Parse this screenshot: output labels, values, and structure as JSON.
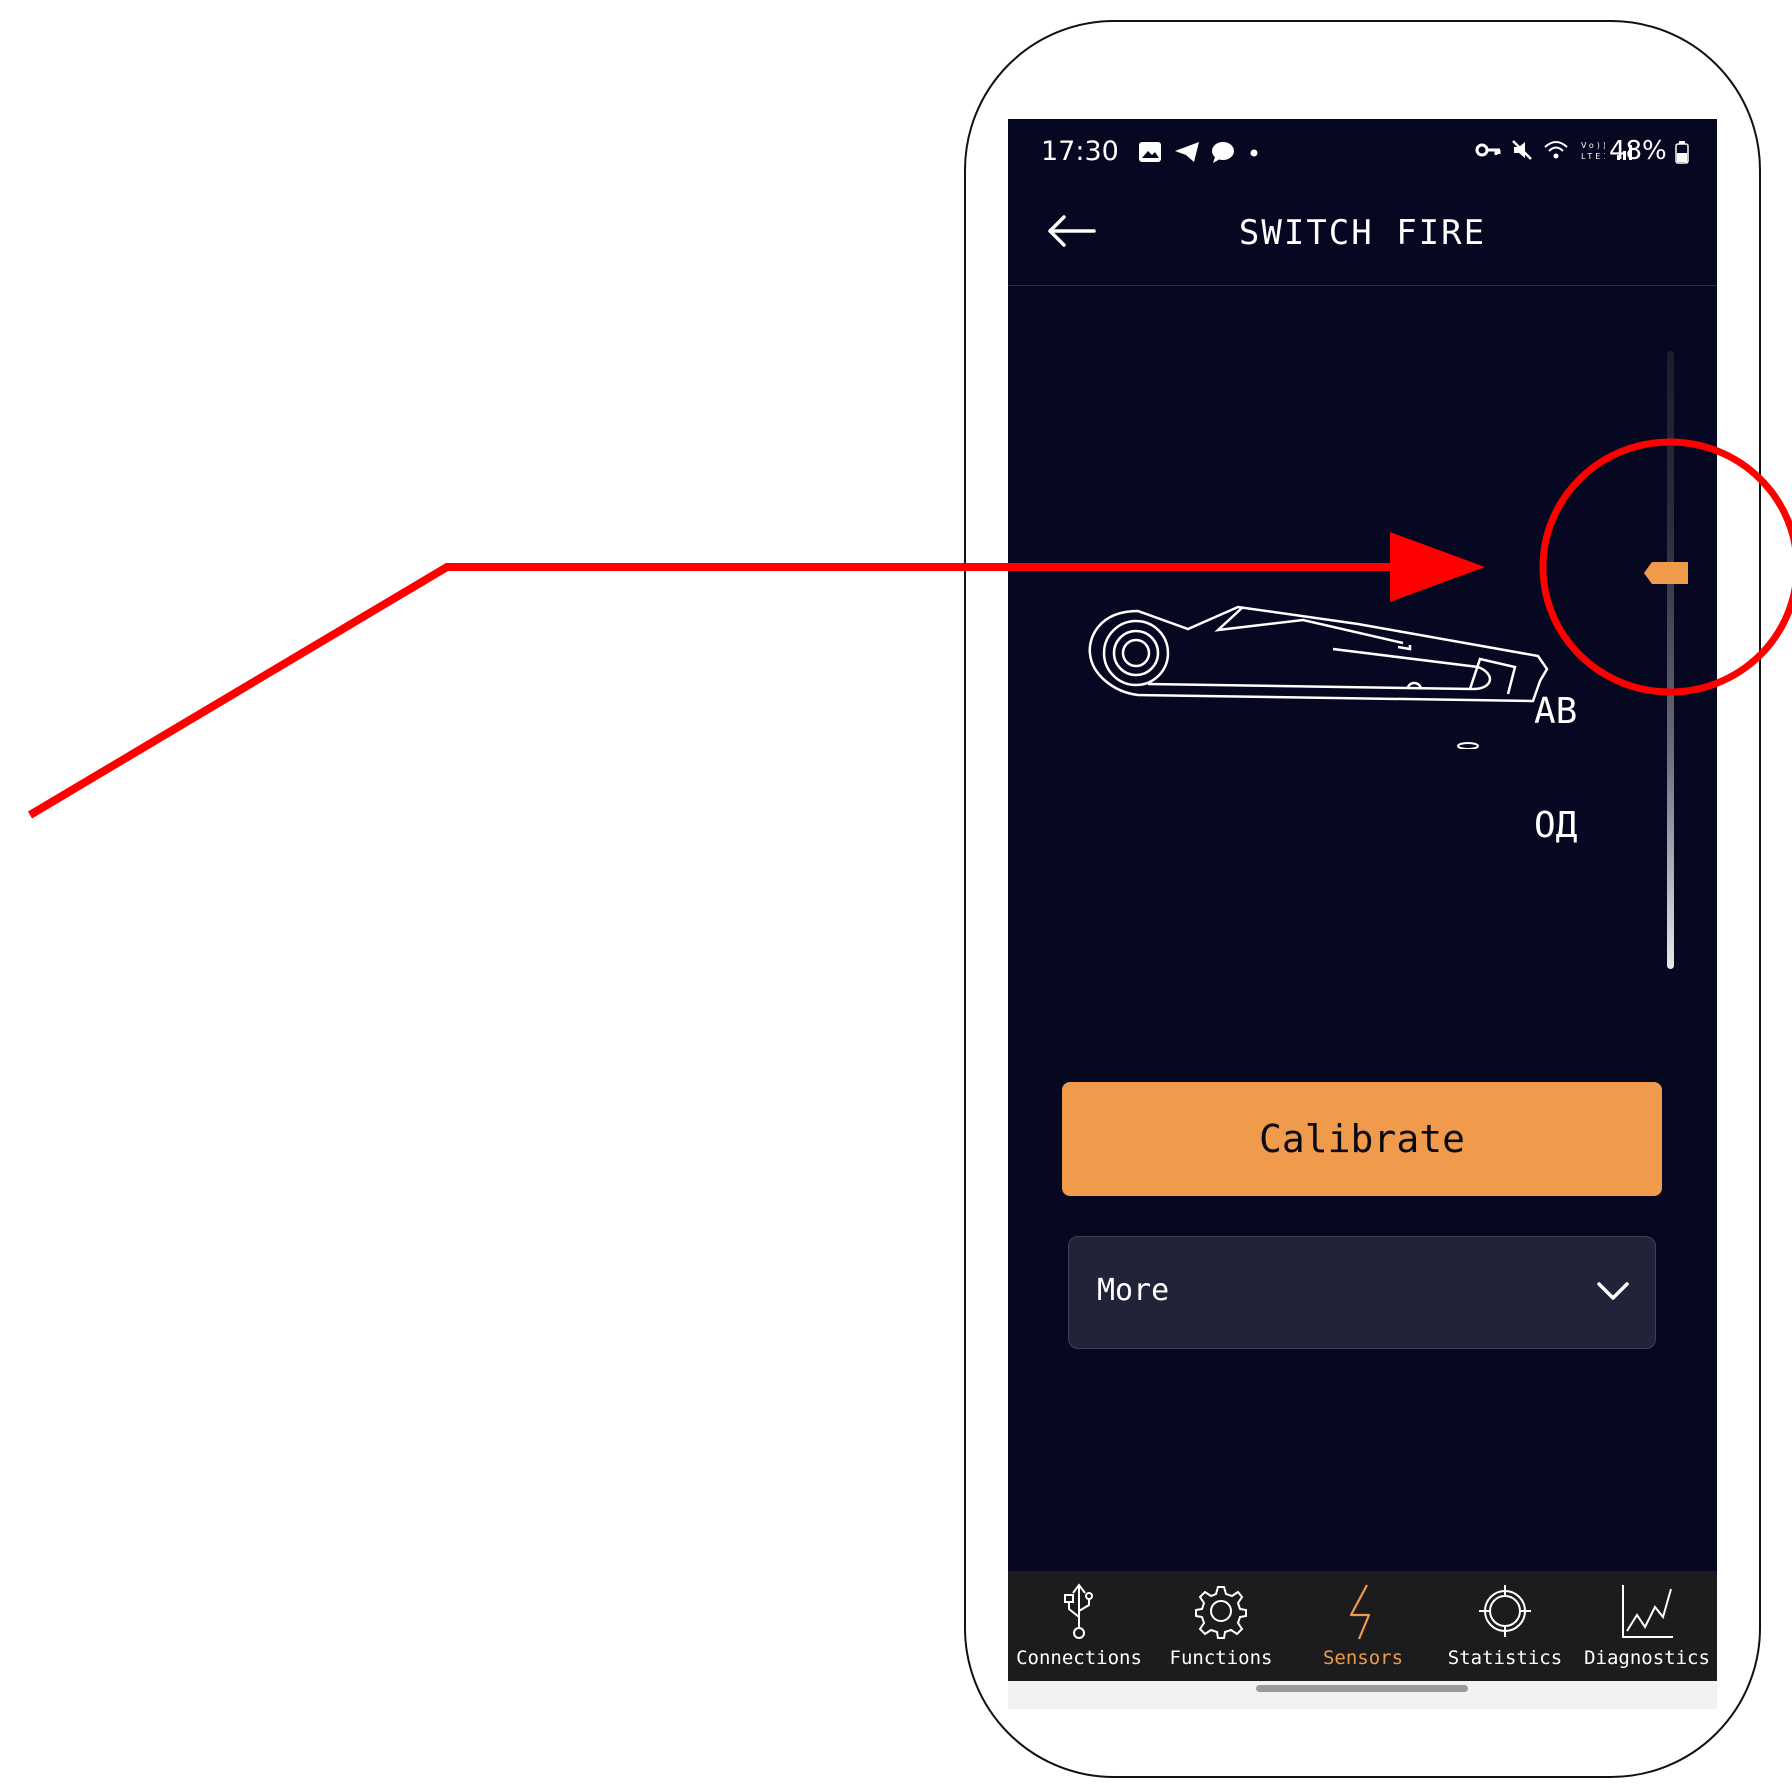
{
  "status_bar": {
    "time": "17:30",
    "left_icons": [
      "image-icon",
      "telegram-icon",
      "chat-icon",
      "dot-icon"
    ],
    "right_icons": [
      "vpn-key-icon",
      "mute-icon",
      "wifi-icon",
      "volte-icon",
      "signal-icon"
    ],
    "battery": "48%"
  },
  "app_bar": {
    "title": "SWITCH FIRE",
    "back_icon": "arrow-left-icon"
  },
  "sensor": {
    "label_top": "AB",
    "label_bottom": "ОД",
    "thumb_color": "#f09a4b"
  },
  "actions": {
    "calibrate": "Calibrate",
    "more": "More"
  },
  "bottom_nav": {
    "items": [
      {
        "label": "Connections",
        "icon": "usb-icon"
      },
      {
        "label": "Functions",
        "icon": "gear-icon"
      },
      {
        "label": "Sensors",
        "icon": "bolt-icon",
        "active": true
      },
      {
        "label": "Statistics",
        "icon": "crosshair-icon"
      },
      {
        "label": "Diagnostics",
        "icon": "chart-icon"
      }
    ],
    "active_color": "#f09a4b"
  },
  "annotation": {
    "color": "#ff0000"
  }
}
